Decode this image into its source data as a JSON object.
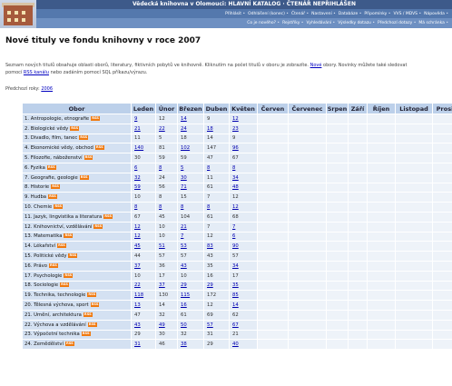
{
  "header": {
    "title": "Vědecká knihovna v Olomouci: HLAVNÍ KATALOG · ČTENÁŘ NEPŘIHLÁŠEN",
    "nav_row1": [
      "Přihlásit",
      "Odhlášení (konec)",
      "Čtenář",
      "Nastavení",
      "Databáze",
      "Připomínky",
      "VVS / MDVS",
      "Nápověda"
    ],
    "nav_row2": [
      "Co je nového?",
      "Rejstříky",
      "Vyhledávání",
      "Výsledky dotazu",
      "Předchozí dotazy",
      "Má schránka"
    ]
  },
  "page_title": "Nové tituly ve fondu knihovny v roce 2007",
  "intro": {
    "text_a": "Seznam nových titulů obsahuje oblasti oborů, literatury, fiktivních pobytů ve knihovně. Kliknutím na počet titulů v oboru je zobrazíte.",
    "link_a": "Nové",
    "text_b": "obory. Novinky můžete také sledovat pomocí",
    "link_b": "RSS kanálu",
    "text_c": "nebo zadáním pomocí SQL příkazu/výrazu."
  },
  "prev": {
    "label": "Předchozí roky:",
    "link": "2006"
  },
  "rss_label": "RSS",
  "table": {
    "headers": [
      "Obor",
      "Leden",
      "Únor",
      "Březen",
      "Duben",
      "Květen",
      "Červen",
      "Červenec",
      "Srpen",
      "Září",
      "Říjen",
      "Listopad",
      "Prosinec"
    ],
    "rows": [
      {
        "name": "1. Antropologie, etnografie",
        "values": [
          "9",
          "12",
          "14",
          "9",
          "12"
        ]
      },
      {
        "name": "2. Biologické vědy",
        "values": [
          "21",
          "22",
          "24",
          "18",
          "23"
        ]
      },
      {
        "name": "3. Divadlo, film, tanec",
        "values": [
          "11",
          "5",
          "18",
          "14",
          "9"
        ]
      },
      {
        "name": "4. Ekonomické vědy, obchod",
        "values": [
          "140",
          "81",
          "102",
          "147",
          "96"
        ]
      },
      {
        "name": "5. Filozofie, náboženství",
        "values": [
          "30",
          "59",
          "59",
          "47",
          "67"
        ]
      },
      {
        "name": "6. Fyzika",
        "values": [
          "6",
          "8",
          "5",
          "8",
          "8"
        ]
      },
      {
        "name": "7. Geografie, geologie",
        "values": [
          "32",
          "24",
          "30",
          "11",
          "34"
        ]
      },
      {
        "name": "8. Historie",
        "values": [
          "59",
          "56",
          "71",
          "61",
          "48"
        ]
      },
      {
        "name": "9. Hudba",
        "values": [
          "10",
          "8",
          "15",
          "7",
          "12"
        ]
      },
      {
        "name": "10. Chemie",
        "values": [
          "8",
          "8",
          "8",
          "8",
          "12"
        ]
      },
      {
        "name": "11. Jazyk, lingvistika a literatura",
        "values": [
          "67",
          "45",
          "104",
          "61",
          "68"
        ]
      },
      {
        "name": "12. Knihovnictví, vzdělávání",
        "values": [
          "12",
          "10",
          "21",
          "7",
          "7"
        ]
      },
      {
        "name": "13. Matematika",
        "values": [
          "12",
          "10",
          "7",
          "12",
          "6"
        ]
      },
      {
        "name": "14. Lékařství",
        "values": [
          "45",
          "51",
          "53",
          "83",
          "90"
        ]
      },
      {
        "name": "15. Politické vědy",
        "values": [
          "44",
          "57",
          "57",
          "43",
          "57"
        ]
      },
      {
        "name": "16. Právo",
        "values": [
          "37",
          "36",
          "43",
          "35",
          "34"
        ]
      },
      {
        "name": "17. Psychologie",
        "values": [
          "10",
          "17",
          "10",
          "16",
          "17"
        ]
      },
      {
        "name": "18. Sociologie",
        "values": [
          "22",
          "37",
          "29",
          "29",
          "35"
        ]
      },
      {
        "name": "19. Technika, technologie",
        "values": [
          "118",
          "130",
          "115",
          "172",
          "85"
        ]
      },
      {
        "name": "20. Tělesná výchova, sport",
        "values": [
          "13",
          "14",
          "16",
          "12",
          "14"
        ]
      },
      {
        "name": "21. Umění, architektura",
        "values": [
          "47",
          "32",
          "61",
          "69",
          "62"
        ]
      },
      {
        "name": "22. Výchova a vzdělávání",
        "values": [
          "43",
          "49",
          "50",
          "57",
          "67"
        ]
      },
      {
        "name": "23. Výpočetní technika",
        "values": [
          "29",
          "30",
          "32",
          "31",
          "21"
        ]
      },
      {
        "name": "24. Zemědělství",
        "values": [
          "31",
          "46",
          "38",
          "29",
          "40"
        ]
      }
    ]
  },
  "colors": {
    "header_dark": "#3d5a8a",
    "header_mid": "#5478ad",
    "header_light": "#6e90c2",
    "table_head": "#bcd0ea",
    "rss": "#f07a10",
    "link": "#0000c0"
  }
}
